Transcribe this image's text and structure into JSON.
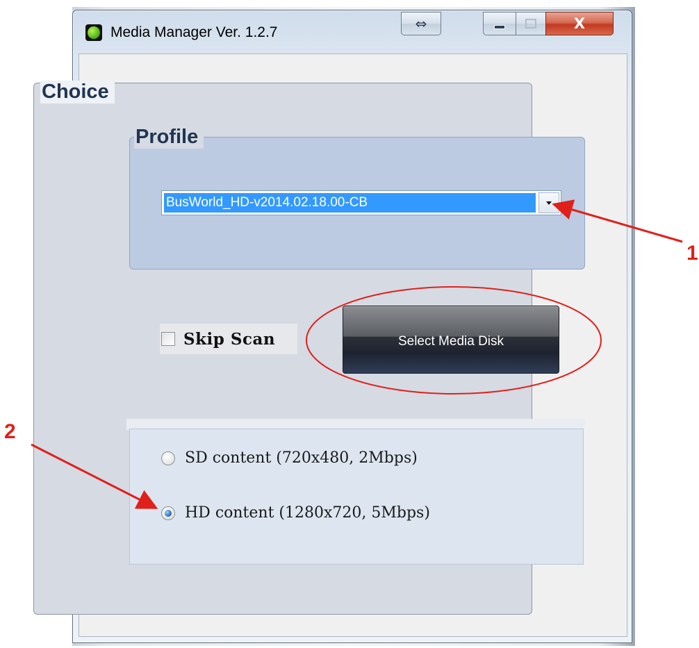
{
  "window": {
    "title": "Media Manager Ver. 1.2.7",
    "close_glyph": "X",
    "resize_glyph": "⇔"
  },
  "choice": {
    "legend": "Choice",
    "profile": {
      "legend": "Profile",
      "selected": "BusWorld_HD-v2014.02.18.00-CB"
    },
    "skip_scan": {
      "label": "Skip Scan",
      "checked": false
    },
    "select_button_label": "Select Media Disk",
    "content_options": [
      {
        "label": "SD content (720x480, 2Mbps)",
        "checked": false
      },
      {
        "label": "HD content (1280x720, 5Mbps)",
        "checked": true
      }
    ]
  },
  "annotations": {
    "marker_1": "1",
    "marker_2": "2",
    "color": "#e0201b"
  }
}
